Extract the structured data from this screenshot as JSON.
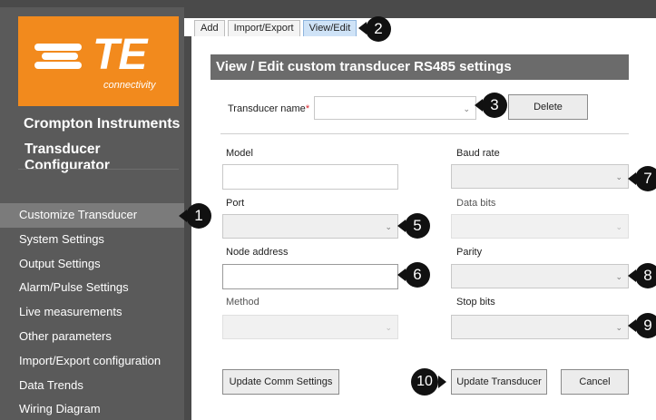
{
  "brand": {
    "logo_text": "TE",
    "logo_sub": "connectivity",
    "company": "Crompton Instruments",
    "product": "Transducer Configurator",
    "logo_color": "#f28a1d"
  },
  "nav": {
    "items": [
      {
        "label": "Customize Transducer",
        "active": true
      },
      {
        "label": "System Settings"
      },
      {
        "label": "Output Settings"
      },
      {
        "label": "Alarm/Pulse Settings"
      },
      {
        "label": "Live measurements"
      },
      {
        "label": "Other parameters"
      },
      {
        "label": "Import/Export configuration"
      },
      {
        "label": "Data Trends"
      },
      {
        "label": "Wiring Diagram"
      }
    ]
  },
  "tabs": [
    {
      "label": "Add"
    },
    {
      "label": "Import/Export"
    },
    {
      "label": "View/Edit",
      "active": true
    }
  ],
  "section_title": "View / Edit custom transducer RS485 settings",
  "form": {
    "transducer_name_label": "Transducer name",
    "required_marker": "*",
    "transducer_name_value": "",
    "delete_label": "Delete",
    "model_label": "Model",
    "model_value": "",
    "baud_rate_label": "Baud rate",
    "port_label": "Port",
    "data_bits_label": "Data bits",
    "node_address_label": "Node address",
    "node_address_value": "",
    "parity_label": "Parity",
    "method_label": "Method",
    "stop_bits_label": "Stop bits",
    "update_comm_label": "Update Comm Settings",
    "update_transducer_label": "Update Transducer",
    "cancel_label": "Cancel"
  },
  "callouts": {
    "c1": "1",
    "c2": "2",
    "c3": "3",
    "c5": "5",
    "c6": "6",
    "c7": "7",
    "c8": "8",
    "c9": "9",
    "c10": "10"
  }
}
